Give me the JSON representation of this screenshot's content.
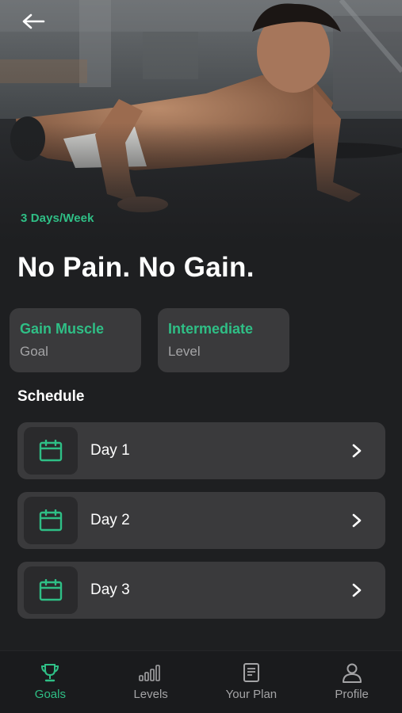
{
  "hero": {
    "frequency": "3 Days/Week"
  },
  "title": "No Pain. No Gain.",
  "info_cards": {
    "goal": {
      "value": "Gain Muscle",
      "caption": "Goal"
    },
    "level": {
      "value": "Intermediate",
      "caption": "Level"
    }
  },
  "schedule": {
    "heading": "Schedule",
    "days": [
      {
        "label": "Day 1"
      },
      {
        "label": "Day 2"
      },
      {
        "label": "Day 3"
      }
    ]
  },
  "nav": {
    "items": [
      {
        "label": "Goals",
        "icon": "trophy-icon",
        "active": true
      },
      {
        "label": "Levels",
        "icon": "bar-levels-icon",
        "active": false
      },
      {
        "label": "Your Plan",
        "icon": "document-icon",
        "active": false
      },
      {
        "label": "Profile",
        "icon": "person-icon",
        "active": false
      }
    ]
  },
  "colors": {
    "accent": "#2fbf86",
    "background": "#1e1f21",
    "card": "#3a3a3c",
    "muted_text": "#a4a4a6"
  }
}
